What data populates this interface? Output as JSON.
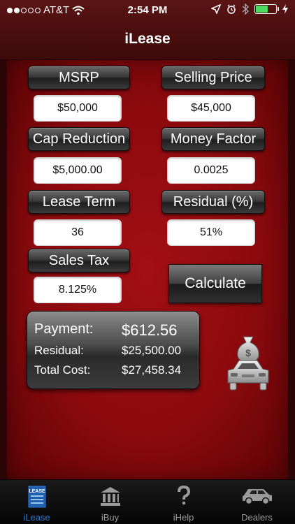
{
  "status_bar": {
    "carrier": "AT&T",
    "time": "2:54 PM"
  },
  "nav": {
    "title": "iLease"
  },
  "fields": {
    "msrp": {
      "label": "MSRP",
      "value": "$50,000"
    },
    "selling_price": {
      "label": "Selling Price",
      "value": "$45,000"
    },
    "cap_reduction": {
      "label": "Cap Reduction",
      "value": "$5,000.00"
    },
    "money_factor": {
      "label": "Money Factor",
      "value": "0.0025"
    },
    "lease_term": {
      "label": "Lease Term",
      "value": "36"
    },
    "residual_pct": {
      "label": "Residual (%)",
      "value": "51%"
    },
    "sales_tax": {
      "label": "Sales Tax",
      "value": "8.125%"
    }
  },
  "calculate_label": "Calculate",
  "results": {
    "payment": {
      "label": "Payment:",
      "value": "$612.56"
    },
    "residual": {
      "label": "Residual:",
      "value": "$25,500.00"
    },
    "total_cost": {
      "label": "Total Cost:",
      "value": "$27,458.34"
    }
  },
  "tabs": [
    {
      "label": "iLease",
      "icon": "lease-doc-icon",
      "active": true
    },
    {
      "label": "iBuy",
      "icon": "bank-icon",
      "active": false
    },
    {
      "label": "iHelp",
      "icon": "question-icon",
      "active": false
    },
    {
      "label": "Dealers",
      "icon": "car-icon",
      "active": false
    }
  ],
  "icon_text": {
    "lease": "LEASE"
  },
  "colors": {
    "accent_tab": "#2d7ad6",
    "panel_red": "#a30f14",
    "battery_green": "#4cd964"
  }
}
